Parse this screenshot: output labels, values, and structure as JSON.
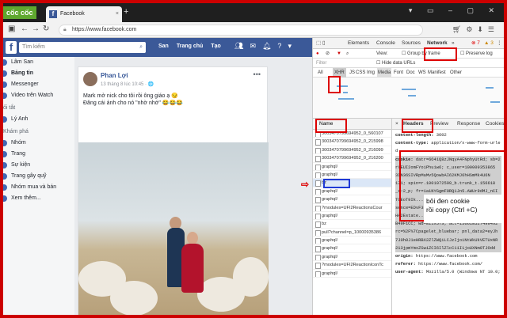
{
  "browser": {
    "logo": "cốc cốc",
    "tab_title": "Facebook",
    "url": "https://www.facebook.com"
  },
  "facebook": {
    "search_placeholder": "Tìm kiếm",
    "nav": [
      "San",
      "Trang chủ",
      "Tạo"
    ],
    "sidebar": [
      {
        "label": "Lâm San",
        "type": "item"
      },
      {
        "label": "Bảng tin",
        "type": "sel"
      },
      {
        "label": "Messenger",
        "type": "item"
      },
      {
        "label": "Video trên Watch",
        "type": "item"
      },
      {
        "label": "ối tắt",
        "type": "hdr"
      },
      {
        "label": "Lý Anh",
        "type": "item"
      },
      {
        "label": "Khám phá",
        "type": "hdr"
      },
      {
        "label": "Nhóm",
        "type": "item"
      },
      {
        "label": "Trang",
        "type": "item"
      },
      {
        "label": "Sự kiện",
        "type": "item"
      },
      {
        "label": "Trang gây quỹ",
        "type": "item"
      },
      {
        "label": "Nhóm mua và bán",
        "type": "item"
      },
      {
        "label": "Xem thêm...",
        "type": "item"
      }
    ],
    "post": {
      "author": "Phan Lợi",
      "meta": "13 tháng 8 lúc 10:45 · 🌐",
      "line1": "Mark mở nick cho tôi rồi ông giáo ạ 😏",
      "line2": "Đăng cái ảnh cho nó \"nhờ nhớ\" 😂😂😂"
    }
  },
  "devtools": {
    "tabs": [
      "Elements",
      "Console",
      "Sources",
      "Network",
      "»"
    ],
    "errors": "⊗ 7",
    "warnings": "▲ 3",
    "toolbar": {
      "view": "View:",
      "group": "Group by frame",
      "preserve": "Preserve log"
    },
    "filter": {
      "placeholder": "Filter",
      "hide": "Hide data URLs"
    },
    "types": [
      "All",
      "XHR",
      "JS",
      "CSS",
      "Img",
      "Media",
      "Font",
      "Doc",
      "WS",
      "Manifest",
      "Other"
    ],
    "name_header": "Name",
    "requests": [
      "3003470799694952_0_560107",
      "3003470799694952_0_215998",
      "3003470799694952_0_216099",
      "3003470799694952_0_216200",
      "graphql/",
      "graphql/",
      "bz",
      "graphql/",
      "graphql/",
      "?modules=UFI2ReactionsCour",
      "graphql/",
      "bz",
      "pull?channel=p_10000935386",
      "graphql/",
      "graphql/",
      "graphql/",
      "?modules=UFI2ReactionIconTc",
      "graphql/"
    ],
    "detail_tabs": [
      "×",
      "Headers",
      "Preview",
      "Response",
      "Cookies"
    ],
    "headers": [
      {
        "k": "content-length:",
        "v": " 3602"
      },
      {
        "k": "content-type:",
        "v": " application/x-www-form-urle"
      },
      {
        "k": "",
        "v": "d"
      },
      {
        "k": "cookie:",
        "v": " datr=6O41Q8zJNqyA4FNphyUtRd; sb=2"
      },
      {
        "k": "",
        "v": "rYEUI2omFYoiPhuiw6; c_user=100009353865"
      },
      {
        "k": "",
        "v": "3IN36SIVRpMaMv5QowbAI62KMJ6hHSmMk4U6N"
      },
      {
        "k": "",
        "v": "171; spin=r.1001072599_b.trunk_t.156618"
      },
      {
        "k": "",
        "v": "_s:2_p; fr=1a1NYGgmF0RQ1Jn5.AWUr9dMJ_nCI"
      },
      {
        "k": "",
        "v": "TCEoT9Ik...FDeRGGmYYTy8dH5ad9f1BXBnc..."
      },
      {
        "k": "",
        "v": "sence=EDvF3EtimeF1566185240EuserFA21000"
      },
      {
        "k": "",
        "v": "HA2Estate..."
      },
      {
        "k": "",
        "v": "B49F1CC; wd=811x573; act=1566185274994%2"
      },
      {
        "k": "",
        "v": "rc=%2F%7Cpagelet_bluebar; pnl_data2=eyJh"
      },
      {
        "k": "",
        "v": "7J0h0J1eHRBX2ZlZWQiLCJzIjoiNtWkUkVETUxNR"
      },
      {
        "k": "",
        "v": "213jpmYmxZSwiZCI6IlZlcC11I1joUXNm0TJOdd"
      },
      {
        "k": "origin:",
        "v": " https://www.facebook.com"
      },
      {
        "k": "referer:",
        "v": " https://www.facebook.com/"
      },
      {
        "k": "user-agent:",
        "v": " Mozilla/5.0 (Windows NT 10.0;"
      }
    ]
  },
  "annotation": {
    "line1": "bôi đen cookie",
    "line2": "rồi   copy (Ctrl +C)",
    "arrow": "⇨"
  },
  "colors": {
    "border": "#cc0000",
    "facebook_blue": "#3b5998",
    "highlight_blue": "#1f3ad6"
  }
}
